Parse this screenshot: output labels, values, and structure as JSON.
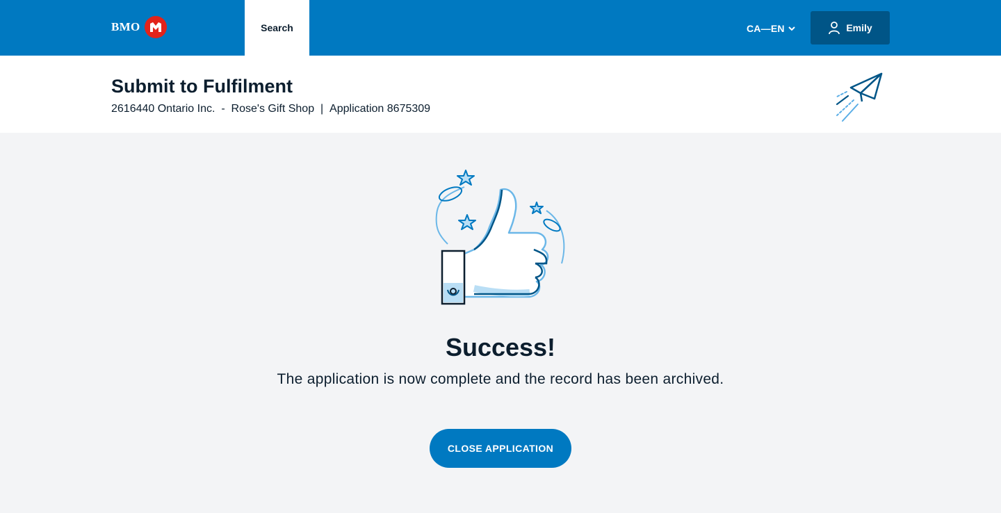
{
  "topbar": {
    "brand": "BMO",
    "nav_search": "Search",
    "language": "CA—EN",
    "user_name": "Emily"
  },
  "header": {
    "title": "Submit to Fulfilment",
    "company": "2616440 Ontario Inc.",
    "sep1": "  -  ",
    "store": "Rose's Gift Shop",
    "sep2": "  |  ",
    "application": "Application 8675309"
  },
  "main": {
    "success_title": "Success!",
    "success_message": "The application is now complete and the record has been archived.",
    "close_button": "CLOSE APPLICATION"
  },
  "colors": {
    "brand_blue": "#0079c1",
    "dark_blue": "#005587",
    "bmo_red": "#e2231a",
    "text": "#0c1e2e",
    "background": "#f3f4f6"
  },
  "icons": [
    "bmo-roundel-icon",
    "chevron-down-icon",
    "user-icon",
    "paper-plane-icon",
    "thumbs-up-illustration"
  ]
}
